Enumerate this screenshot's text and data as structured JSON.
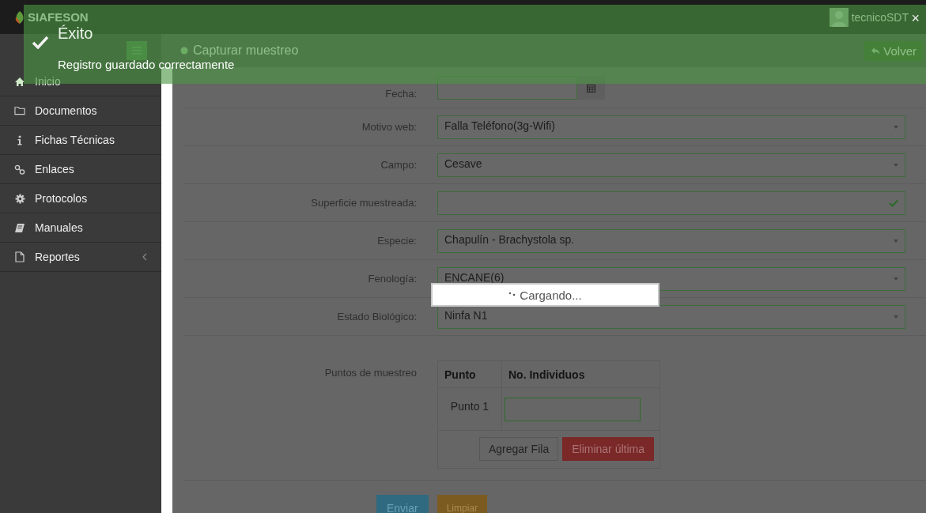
{
  "header": {
    "brand": "SIAFESON",
    "user": "tecnicoSDT"
  },
  "toast": {
    "title": "Éxito",
    "message": "Registro guardado correctamente",
    "close": "×"
  },
  "sidebar": {
    "items": [
      {
        "label": "Inicio",
        "has_submenu": false
      },
      {
        "label": "Documentos",
        "has_submenu": false
      },
      {
        "label": "Fichas Técnicas",
        "has_submenu": false
      },
      {
        "label": "Enlaces",
        "has_submenu": false
      },
      {
        "label": "Protocolos",
        "has_submenu": false
      },
      {
        "label": "Manuales",
        "has_submenu": false
      },
      {
        "label": "Reportes",
        "has_submenu": true
      }
    ]
  },
  "page": {
    "title": "Capturar muestreo",
    "back_button": "Volver"
  },
  "form": {
    "fields": [
      {
        "label": "Fecha:",
        "kind": "date"
      },
      {
        "label": "Motivo web:",
        "kind": "select",
        "value": "Falla Teléfono(3g-Wifi)"
      },
      {
        "label": "Campo:",
        "kind": "select",
        "value": "Cesave"
      },
      {
        "label": "Superficie muestreada:",
        "kind": "valid"
      },
      {
        "label": "Especie:",
        "kind": "select",
        "value": "Chapulín - Brachystola sp."
      },
      {
        "label": "Fenología:",
        "kind": "select",
        "value": "ENCANE(6)"
      },
      {
        "label": "Estado Biológico:",
        "kind": "select",
        "value": "Ninfa N1"
      }
    ]
  },
  "points": {
    "label": "Puntos de muestreo",
    "columns": [
      "Punto",
      "No. Individuos"
    ],
    "rows": [
      {
        "point": "Punto 1"
      }
    ],
    "add_button": "Agregar Fila",
    "remove_button": "Eliminar última"
  },
  "actions": {
    "submit": "Enviar",
    "reset": "Limpiar"
  },
  "loading": {
    "text": "Cargando..."
  }
}
